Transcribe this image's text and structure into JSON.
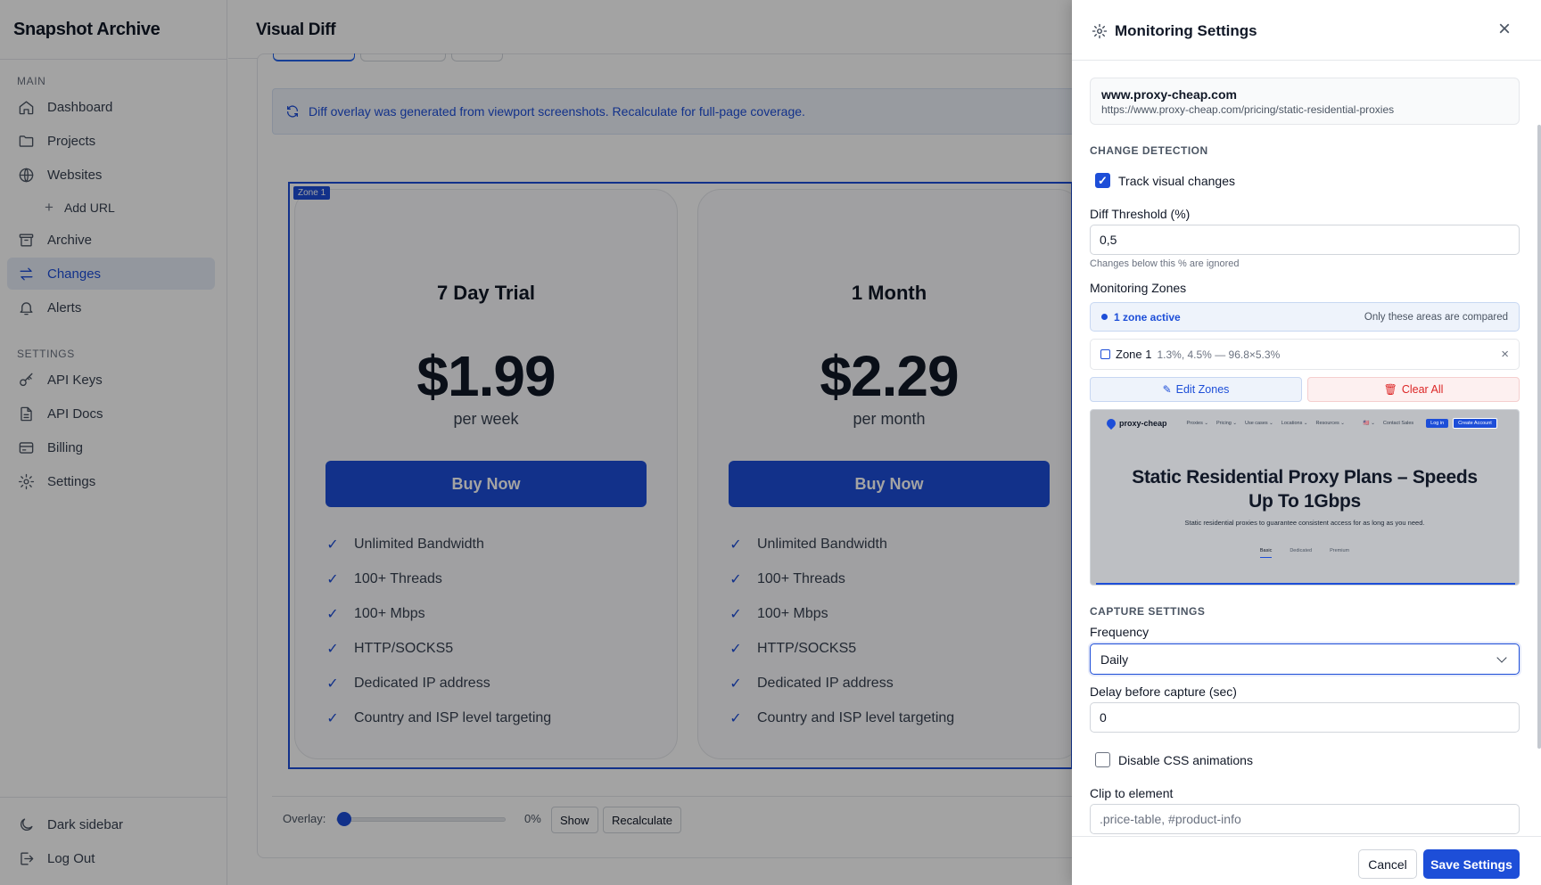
{
  "app": {
    "brand": "Snapshot Archive",
    "page_title": "Visual Diff"
  },
  "sidebar": {
    "main_label": "MAIN",
    "settings_label": "SETTINGS",
    "items": [
      {
        "label": "Dashboard",
        "icon": "home-icon"
      },
      {
        "label": "Projects",
        "icon": "folder-icon"
      },
      {
        "label": "Websites",
        "icon": "globe-icon"
      },
      {
        "label": "Add URL",
        "icon": "plus-icon"
      },
      {
        "label": "Archive",
        "icon": "archive-icon"
      },
      {
        "label": "Changes",
        "icon": "arrows-icon",
        "active": true
      },
      {
        "label": "Alerts",
        "icon": "bell-icon"
      }
    ],
    "settings_items": [
      {
        "label": "API Keys",
        "icon": "key-icon"
      },
      {
        "label": "API Docs",
        "icon": "doc-icon"
      },
      {
        "label": "Billing",
        "icon": "card-icon"
      },
      {
        "label": "Settings",
        "icon": "gear-icon"
      }
    ],
    "bottom": {
      "dark_sidebar": "Dark sidebar",
      "logout": "Log Out"
    }
  },
  "diff": {
    "banner": "Diff overlay was generated from viewport screenshots. Recalculate for full-page coverage.",
    "zone_tag": "Zone 1",
    "plans": [
      {
        "name": "7 Day Trial",
        "price": "$1.99",
        "period": "per week",
        "button": "Buy Now"
      },
      {
        "name": "1 Month",
        "price": "$2.29",
        "period": "per month",
        "button": "Buy Now"
      }
    ],
    "features": [
      "Unlimited Bandwidth",
      "100+ Threads",
      "100+ Mbps",
      "HTTP/SOCKS5",
      "Dedicated IP address",
      "Country and ISP level targeting"
    ],
    "overlay_label": "Overlay:",
    "overlay_value": "0%",
    "overlay_fraction": 0,
    "show_button": "Show",
    "recalc_button": "Recalculate"
  },
  "panel": {
    "title": "Monitoring Settings",
    "site_name": "www.proxy-cheap.com",
    "site_url": "https://www.proxy-cheap.com/pricing/static-residential-proxies",
    "change_detection": "CHANGE DETECTION",
    "track_visual": "Track visual changes",
    "diff_threshold_label": "Diff Threshold (%)",
    "diff_threshold_value": "0,5",
    "diff_threshold_hint": "Changes below this % are ignored",
    "zones_label": "Monitoring Zones",
    "zones_active": "1 zone active",
    "zones_note": "Only these areas are compared",
    "zone_name": "Zone 1",
    "zone_coords": "1.3%, 4.5% — 96.8×5.3%",
    "edit_zones": "Edit Zones",
    "clear_all": "Clear All",
    "preview": {
      "logo": "proxy-cheap",
      "nav": [
        "Proxies ⌄",
        "Pricing ⌄",
        "Use cases ⌄",
        "Locations ⌄",
        "Resources ⌄",
        "🇺🇸 ⌄",
        "Contact Sales"
      ],
      "login": "Log in",
      "create": "Create Account",
      "headline": "Static Residential Proxy Plans – Speeds Up To 1Gbps",
      "sub": "Static residential proxies to guarantee consistent access for as long as you need.",
      "tabs": [
        "Basic",
        "Dedicated",
        "Premium"
      ]
    },
    "capture_settings": "CAPTURE SETTINGS",
    "frequency_label": "Frequency",
    "frequency_value": "Daily",
    "delay_label": "Delay before capture (sec)",
    "delay_value": "0",
    "disable_css": "Disable CSS animations",
    "clip_label": "Clip to element",
    "clip_placeholder": ".price-table, #product-info",
    "cancel": "Cancel",
    "save": "Save Settings"
  }
}
